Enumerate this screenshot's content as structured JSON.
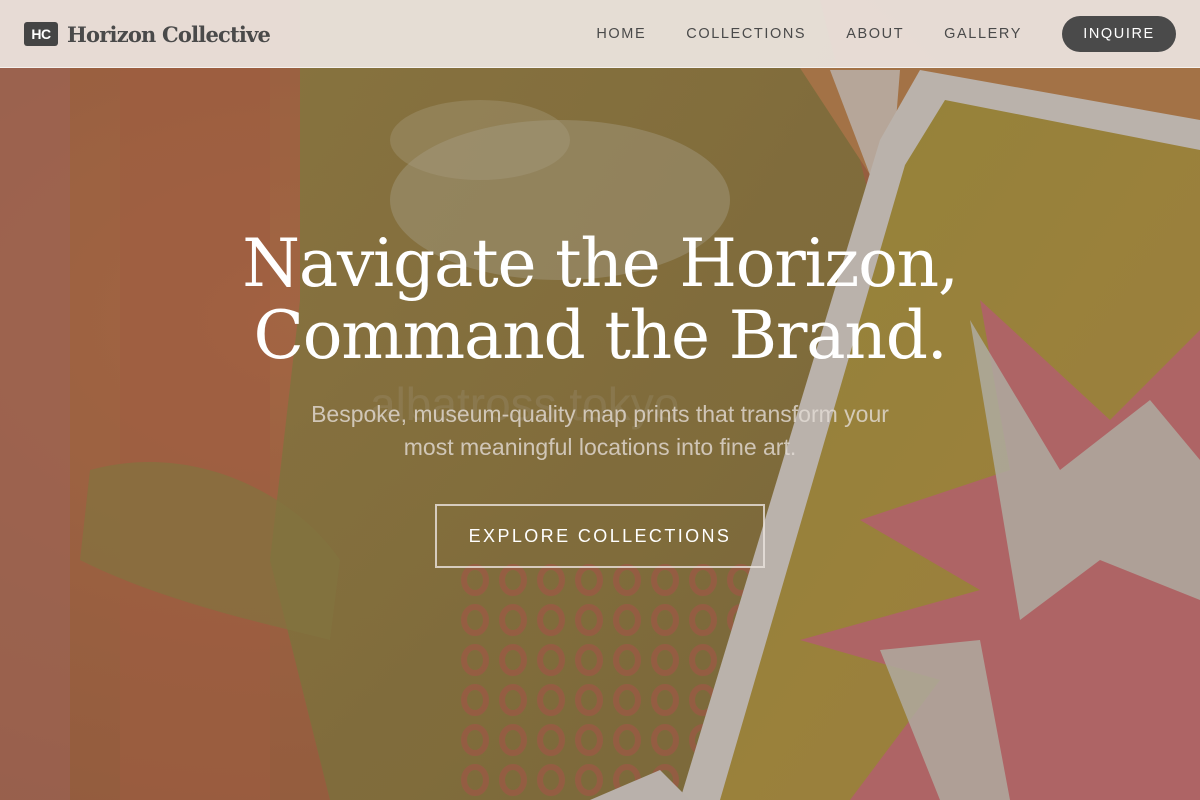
{
  "header": {
    "logo_mark": "HC",
    "brand_name": "Horizon Collective",
    "nav": [
      {
        "label": "HOME"
      },
      {
        "label": "COLLECTIONS"
      },
      {
        "label": "ABOUT"
      },
      {
        "label": "GALLERY"
      }
    ],
    "cta_label": "INQUIRE"
  },
  "hero": {
    "title_line_1": "Navigate the Horizon,",
    "title_line_2": "Command the Brand.",
    "subtitle_line_1": "Bespoke, museum-quality map prints that transform your",
    "subtitle_line_2": "most meaningful locations into fine art.",
    "button_label": "EXPLORE COLLECTIONS",
    "background_image": "abstract-monoprint-artwork"
  },
  "colors": {
    "header_bg": "#f0e9e4",
    "brand_text": "#4a4a4a",
    "cta_bg": "#4a4a4a",
    "title_text": "#ffffff",
    "subtitle_text": "#e4dcd6"
  }
}
